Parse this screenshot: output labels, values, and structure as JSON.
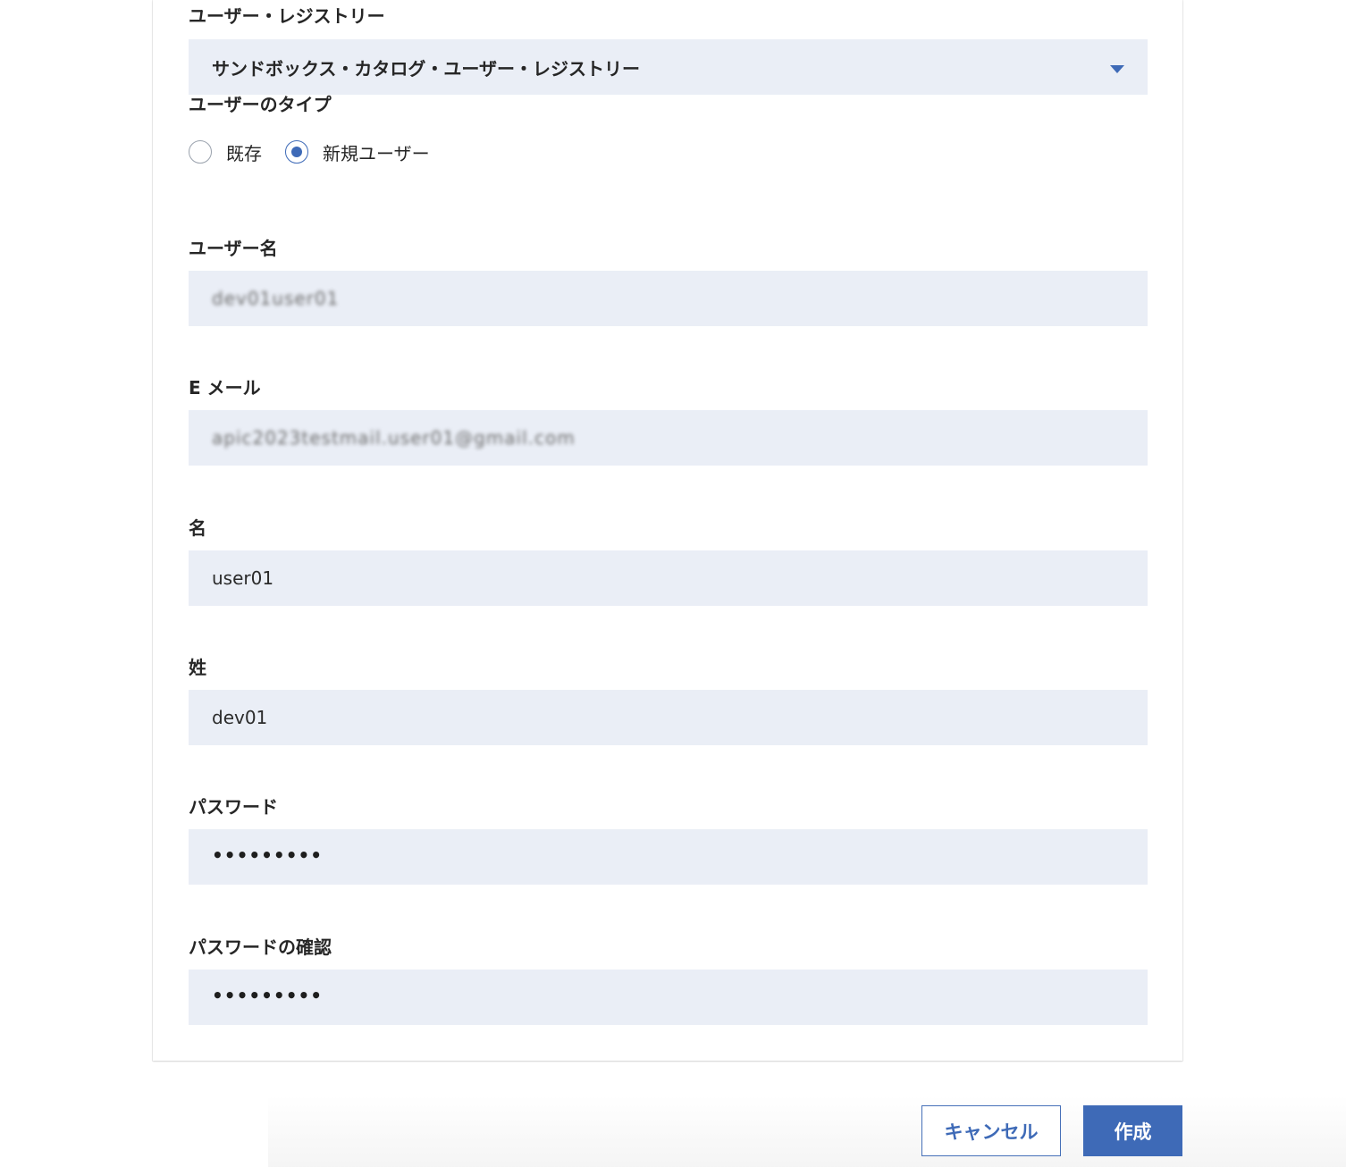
{
  "form": {
    "registry": {
      "label": "ユーザー・レジストリー",
      "selected": "サンドボックス・カタログ・ユーザー・レジストリー",
      "options": [
        "サンドボックス・カタログ・ユーザー・レジストリー"
      ]
    },
    "user_type": {
      "label": "ユーザーのタイプ",
      "options": [
        {
          "label": "既存",
          "checked": false
        },
        {
          "label": "新規ユーザー",
          "checked": true
        }
      ]
    },
    "username": {
      "label": "ユーザー名",
      "value": "dev01user01"
    },
    "email": {
      "label": "E メール",
      "value": "apic2023testmail.user01@gmail.com"
    },
    "first_name": {
      "label": "名",
      "value": "user01"
    },
    "last_name": {
      "label": "姓",
      "value": "dev01"
    },
    "password": {
      "label": "パスワード",
      "value": "•••••••••"
    },
    "confirm_password": {
      "label": "パスワードの確認",
      "value": "•••••••••"
    }
  },
  "actions": {
    "cancel_label": "キャンセル",
    "create_label": "作成"
  },
  "colors": {
    "accent": "#3e6ab7",
    "field_background": "#eaeef6",
    "text": "#262626"
  },
  "icons": {
    "dropdown": "chevron-down-icon"
  }
}
